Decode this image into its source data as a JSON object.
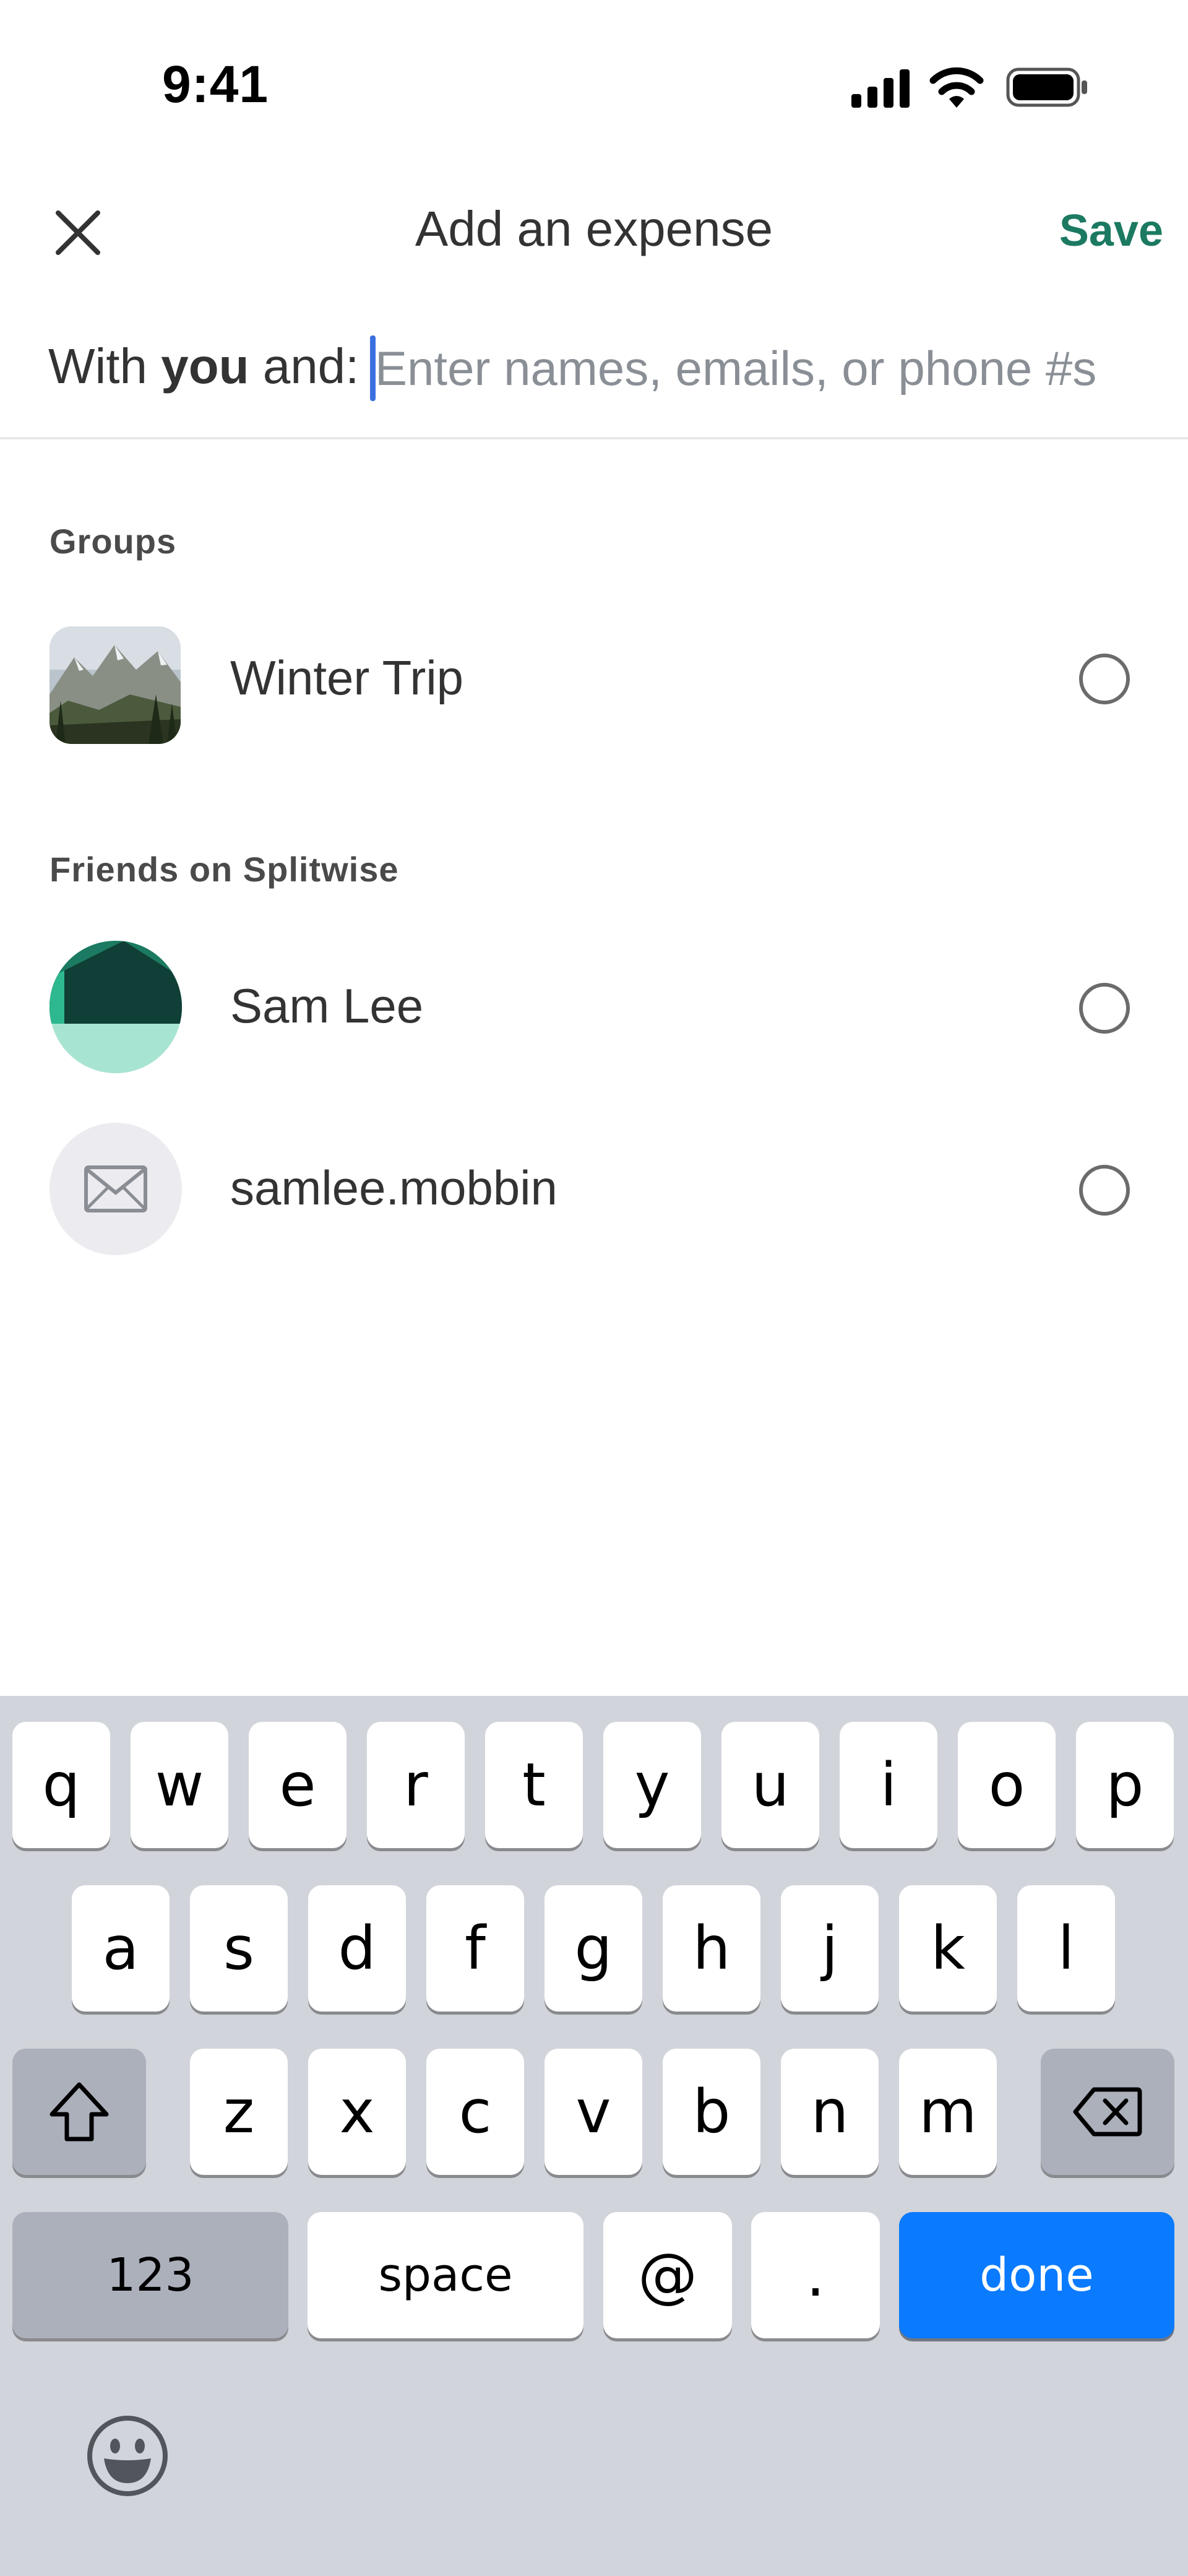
{
  "status_bar": {
    "time": "9:41"
  },
  "header": {
    "title": "Add an expense",
    "save_label": "Save"
  },
  "with_field": {
    "prefix": "With ",
    "you": "you",
    "suffix": " and:",
    "placeholder": "Enter names, emails, or phone #s"
  },
  "groups": {
    "heading": "Groups",
    "items": [
      {
        "label": "Winter Trip",
        "selected": false
      }
    ]
  },
  "friends": {
    "heading": "Friends on Splitwise",
    "items": [
      {
        "label": "Sam Lee",
        "selected": false
      },
      {
        "label": "samlee.mobbin",
        "selected": false
      }
    ]
  },
  "keyboard": {
    "row1": [
      "q",
      "w",
      "e",
      "r",
      "t",
      "y",
      "u",
      "i",
      "o",
      "p"
    ],
    "row2": [
      "a",
      "s",
      "d",
      "f",
      "g",
      "h",
      "j",
      "k",
      "l"
    ],
    "row3": [
      "z",
      "x",
      "c",
      "v",
      "b",
      "n",
      "m"
    ],
    "numbers_label": "123",
    "space_label": "space",
    "at_label": "@",
    "dot_label": ".",
    "done_label": "done"
  },
  "colors": {
    "accent": "#1b7a61",
    "cursor": "#3a6fe0",
    "done_key": "#0a7aff",
    "keyboard_bg": "#d1d4da"
  },
  "icons": [
    "close-icon",
    "cellular-signal-icon",
    "wifi-icon",
    "battery-icon",
    "mail-icon",
    "shift-icon",
    "backspace-icon",
    "emoji-icon"
  ]
}
